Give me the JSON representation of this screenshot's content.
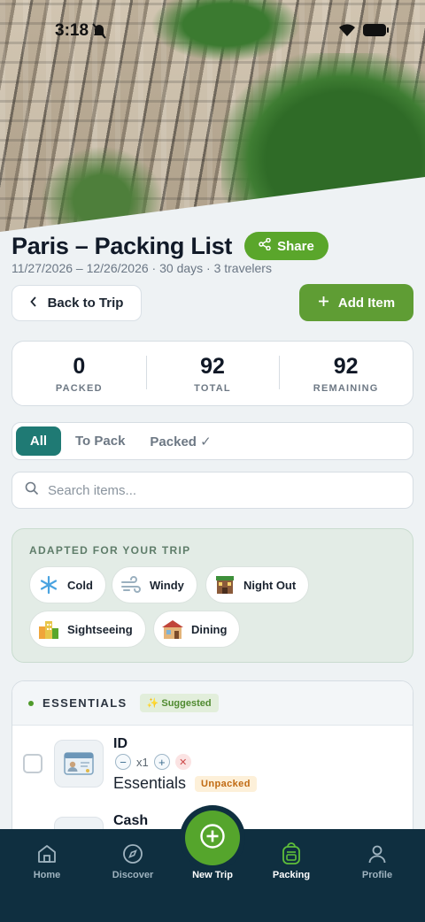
{
  "status": {
    "time": "3:18"
  },
  "header": {
    "title": "Paris – Packing List",
    "share_label": "Share",
    "subtitle": "11/27/2026 – 12/26/2026 · 30 days · 3 travelers"
  },
  "actions": {
    "back_label": "Back to Trip",
    "add_label": "Add Item"
  },
  "stats": [
    {
      "value": "0",
      "label": "PACKED"
    },
    {
      "value": "92",
      "label": "TOTAL"
    },
    {
      "value": "92",
      "label": "REMAINING"
    }
  ],
  "filters": {
    "all": "All",
    "to_pack": "To Pack",
    "packed": "Packed ✓",
    "active": "All"
  },
  "search": {
    "placeholder": "Search items..."
  },
  "adapted": {
    "title": "ADAPTED FOR YOUR TRIP",
    "chips": [
      {
        "label": "Cold",
        "icon": "snowflake-icon"
      },
      {
        "label": "Windy",
        "icon": "wind-icon"
      },
      {
        "label": "Night Out",
        "icon": "building-icon"
      },
      {
        "label": "Sightseeing",
        "icon": "city-icon"
      },
      {
        "label": "Dining",
        "icon": "restaurant-icon"
      }
    ]
  },
  "category": {
    "name": "ESSENTIALS",
    "badge": "✨ Suggested",
    "items": [
      {
        "name": "ID",
        "qty": "x1",
        "category": "Essentials",
        "status": "Unpacked",
        "icon": "id-card-icon"
      },
      {
        "name": "Cash",
        "icon": "cash-icon"
      }
    ]
  },
  "nav": {
    "home": "Home",
    "discover": "Discover",
    "new_trip": "New Trip",
    "packing": "Packing",
    "profile": "Profile",
    "active": "Packing"
  },
  "colors": {
    "primary_green": "#5aa62b",
    "teal": "#1f7a74",
    "nav_bg": "#0f2f40"
  }
}
